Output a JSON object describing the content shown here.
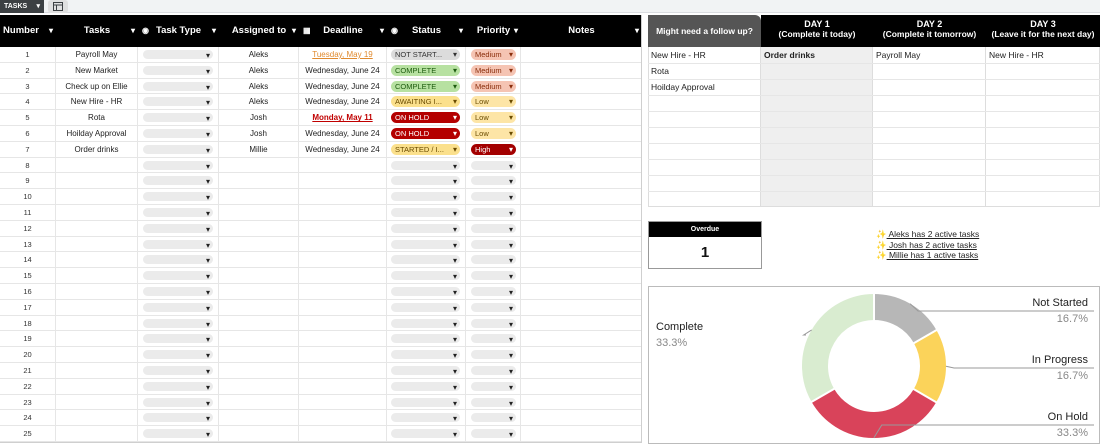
{
  "tab": {
    "name": "TASKS"
  },
  "columns": {
    "number": "Number",
    "tasks": "Tasks",
    "task_type": "Task Type",
    "assigned_to": "Assigned to",
    "deadline": "Deadline",
    "status": "Status",
    "priority": "Priority",
    "notes": "Notes"
  },
  "rows": [
    {
      "num": "1",
      "task": "Payroll  May",
      "assigned": "Aleks",
      "deadline": "Tuesday, May 19",
      "deadline_style": "orange",
      "status": "NOT START...",
      "status_style": "grey",
      "priority": "Medium",
      "priority_style": "pink"
    },
    {
      "num": "2",
      "task": "New Market",
      "assigned": "Aleks",
      "deadline": "Wednesday, June 24",
      "deadline_style": "normal",
      "status": "COMPLETE",
      "status_style": "green",
      "priority": "Medium",
      "priority_style": "pink"
    },
    {
      "num": "3",
      "task": "Check up on Ellie",
      "assigned": "Aleks",
      "deadline": "Wednesday, June 24",
      "deadline_style": "normal",
      "status": "COMPLETE",
      "status_style": "green",
      "priority": "Medium",
      "priority_style": "pink"
    },
    {
      "num": "4",
      "task": "New Hire - HR",
      "assigned": "Aleks",
      "deadline": "Wednesday, June 24",
      "deadline_style": "normal",
      "status": "AWAITING I...",
      "status_style": "yellow",
      "priority": "Low",
      "priority_style": "lyellow"
    },
    {
      "num": "5",
      "task": "Rota",
      "assigned": "Josh",
      "deadline": "Monday, May 11",
      "deadline_style": "red",
      "status": "ON HOLD",
      "status_style": "red",
      "priority": "Low",
      "priority_style": "lyellow"
    },
    {
      "num": "6",
      "task": "Hoilday Approval",
      "assigned": "Josh",
      "deadline": "Wednesday, June 24",
      "deadline_style": "normal",
      "status": "ON HOLD",
      "status_style": "red",
      "priority": "Low",
      "priority_style": "lyellow"
    },
    {
      "num": "7",
      "task": "Order drinks",
      "assigned": "Millie",
      "deadline": "Wednesday, June 24",
      "deadline_style": "normal",
      "status": "STARTED / I...",
      "status_style": "yellow",
      "priority": "High",
      "priority_style": "dred"
    },
    {
      "num": "8"
    },
    {
      "num": "9"
    },
    {
      "num": "10"
    },
    {
      "num": "11"
    },
    {
      "num": "12"
    },
    {
      "num": "13"
    },
    {
      "num": "14"
    },
    {
      "num": "15"
    },
    {
      "num": "16"
    },
    {
      "num": "17"
    },
    {
      "num": "18"
    },
    {
      "num": "19"
    },
    {
      "num": "20"
    },
    {
      "num": "21"
    },
    {
      "num": "22"
    },
    {
      "num": "23"
    },
    {
      "num": "24"
    },
    {
      "num": "25"
    }
  ],
  "followup": {
    "question": "Might need a follow up?",
    "day1": {
      "title": "DAY 1",
      "sub": "(Complete it today)"
    },
    "day2": {
      "title": "DAY 2",
      "sub": "(Complete it tomorrow)"
    },
    "day3": {
      "title": "DAY  3",
      "sub": "(Leave it for the next day)"
    },
    "col0": [
      "New Hire - HR",
      "Rota",
      "Hoilday Approval"
    ],
    "col1": [
      "Order drinks"
    ],
    "col2": [
      "Payroll  May"
    ],
    "col3": [
      "New Hire - HR"
    ]
  },
  "overdue": {
    "label": "Overdue",
    "value": "1"
  },
  "summary": [
    {
      "star": "✨",
      "text": "Aleks has 2 active tasks"
    },
    {
      "star": "✨",
      "text": "Josh  has 2 active tasks"
    },
    {
      "star": "✨",
      "text": "Millie has 1 active tasks"
    }
  ],
  "colors": {
    "header_bg": "#000000",
    "not_started": "#b7b7b7",
    "in_progress": "#fbd35a",
    "on_hold": "#d9435a",
    "complete": "#d9ecd0"
  },
  "chart_data": {
    "type": "pie",
    "donut": true,
    "title": "",
    "legend": "labels-outside",
    "series": [
      {
        "name": "Not Started",
        "value": 16.7,
        "label": "16.7%"
      },
      {
        "name": "In Progress",
        "value": 16.7,
        "label": "16.7%"
      },
      {
        "name": "On Hold",
        "value": 33.3,
        "label": "33.3%"
      },
      {
        "name": "Complete",
        "value": 33.3,
        "label": "33.3%"
      }
    ]
  }
}
